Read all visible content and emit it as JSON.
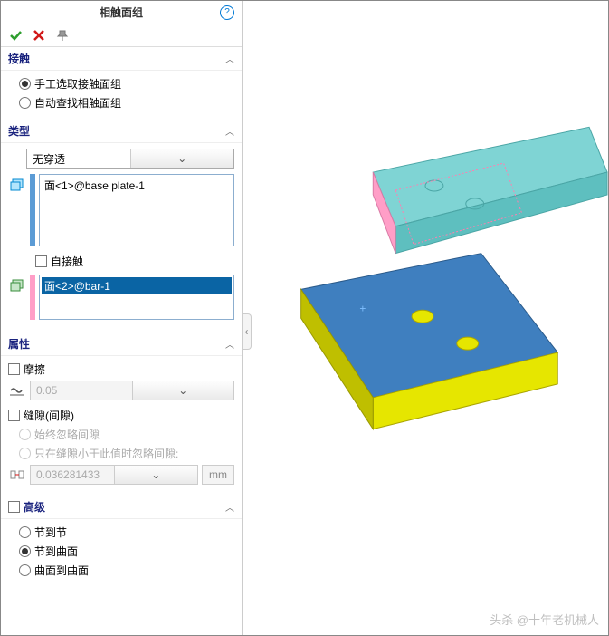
{
  "header": {
    "title": "相触面组",
    "help": "?"
  },
  "actions": {
    "ok_color": "#2e9e2e",
    "cancel_color": "#d11717",
    "pin_color": "#888"
  },
  "contact": {
    "title": "接触",
    "radios": [
      {
        "label": "手工选取接触面组",
        "on": true
      },
      {
        "label": "自动查找相触面组",
        "on": false
      }
    ]
  },
  "type": {
    "title": "类型",
    "combo": "无穿透",
    "face1": "面<1>@base plate-1",
    "self_contact": "自接触",
    "face2": "面<2>@bar-1"
  },
  "props": {
    "title": "属性",
    "friction": "摩擦",
    "friction_val": "0.05",
    "gap": "缝隙(间隙)",
    "gap_r1": "始终忽略间隙",
    "gap_r2": "只在缝隙小于此值时忽略间隙:",
    "gap_val": "0.036281433",
    "gap_unit": "mm"
  },
  "adv": {
    "title": "高级",
    "radios": [
      {
        "label": "节到节",
        "on": false
      },
      {
        "label": "节到曲面",
        "on": true
      },
      {
        "label": "曲面到曲面",
        "on": false
      }
    ]
  },
  "watermark": "头杀 @十年老机械人"
}
